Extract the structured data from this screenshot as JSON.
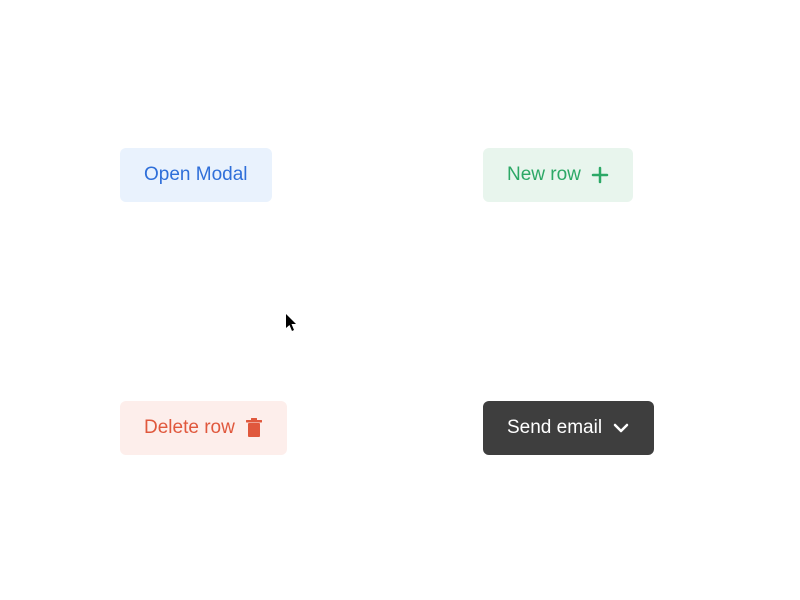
{
  "buttons": {
    "open_modal": {
      "label": "Open Modal"
    },
    "new_row": {
      "label": "New row"
    },
    "delete_row": {
      "label": "Delete row"
    },
    "send_email": {
      "label": "Send email"
    }
  },
  "colors": {
    "blue_bg": "#e9f2fd",
    "blue_text": "#2f6fd9",
    "green_bg": "#e8f5ed",
    "green_text": "#2ca866",
    "red_bg": "#fdeeeb",
    "red_text": "#e0583d",
    "dark_bg": "#3e3e3e",
    "dark_text": "#ffffff"
  }
}
